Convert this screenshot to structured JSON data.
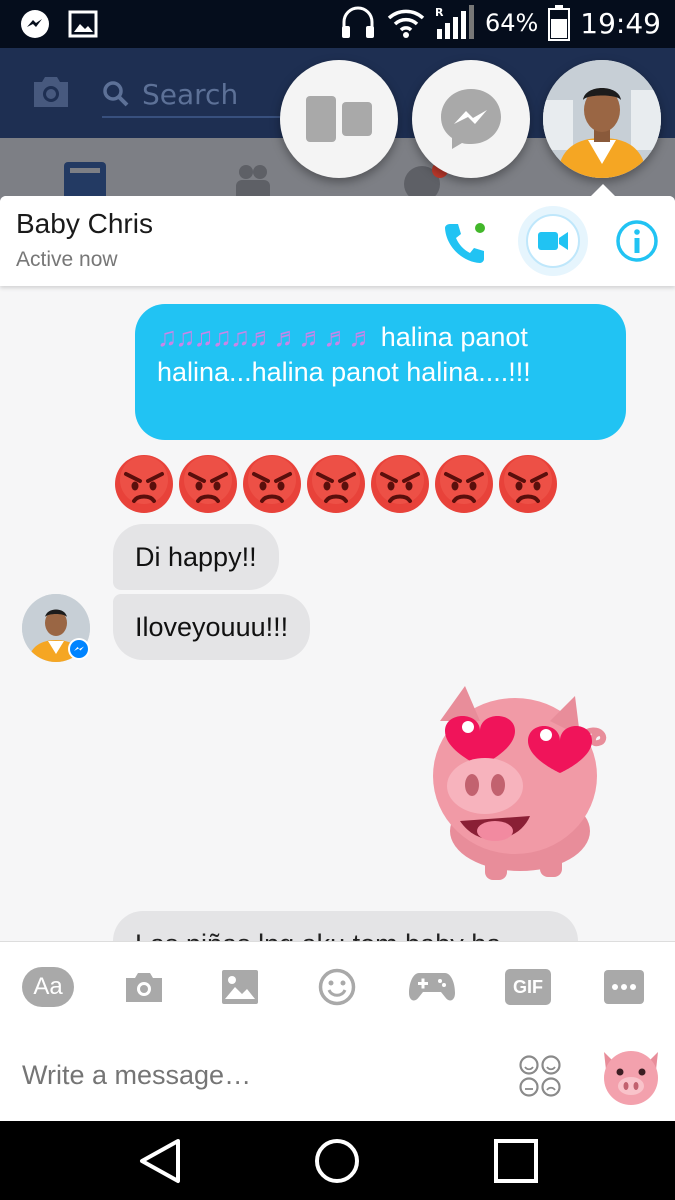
{
  "status_bar": {
    "battery_percent": "64%",
    "time": "19:49",
    "icons": [
      "messenger-icon",
      "gallery-icon",
      "headset-icon",
      "wifi-icon",
      "signal-icon",
      "battery-icon"
    ]
  },
  "fb_header": {
    "search_placeholder": "Search"
  },
  "chat": {
    "contact_name": "Baby Chris",
    "contact_status": "Active now",
    "messages": {
      "outgoing_1_notes": "♫♫♫♫♫♬♬♬♬♬",
      "outgoing_1_text": " halina panot halina...halina panot halina....!!!",
      "angry_reactions": [
        "😡",
        "😡",
        "😡",
        "😡",
        "😡",
        "😡",
        "😡"
      ],
      "incoming_1": "Di happy!!",
      "incoming_2": "Iloveyouuu!!!",
      "incoming_3": "Las piñas lng aku tom baby ha"
    }
  },
  "composer": {
    "placeholder": "Write a message…",
    "tools": [
      "text-icon",
      "camera-icon",
      "gallery-icon",
      "emoji-icon",
      "game-icon",
      "gif-icon",
      "more-icon"
    ],
    "text_tool_label": "Aa",
    "gif_label": "GIF"
  },
  "colors": {
    "outgoing_bubble": "#21c3f3",
    "incoming_bubble": "#e4e4e6",
    "accent": "#21c3f3",
    "status_bar": "#050d1c"
  }
}
